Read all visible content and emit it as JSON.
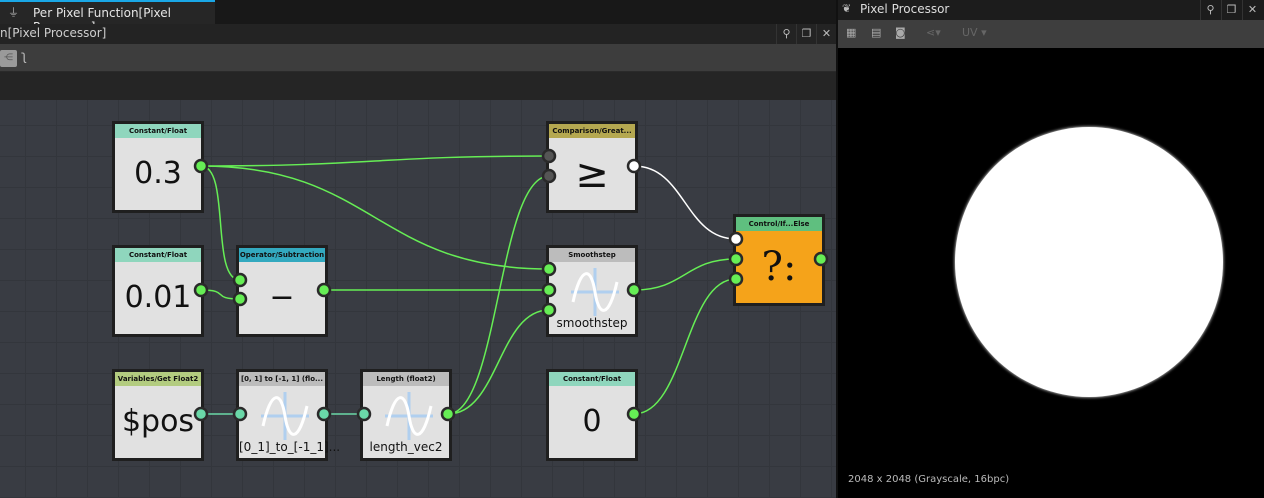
{
  "tab": {
    "label": "Per Pixel Function[Pixel Processor]"
  },
  "left_panel": {
    "title": "n[Pixel Processor]"
  },
  "right_panel": {
    "title": "Pixel Processor",
    "uv_label": "UV",
    "info": "2048 x 2048 (Grayscale, 16bpc)"
  },
  "colors": {
    "const": "#8fd6bd",
    "operator": "#33a9bf",
    "variable": "#b3cc80",
    "function": "#bcbcbc",
    "comparison": "#b5a850",
    "control": "#5fbf7f",
    "ifelse_body": "#f5a31a",
    "wire": "#66ee55",
    "wire_teal": "#6ad8a8"
  },
  "nodes": [
    {
      "id": "c03",
      "header": "Constant/Float",
      "value": "0.3",
      "type": "const"
    },
    {
      "id": "c001",
      "header": "Constant/Float",
      "value": "0.01",
      "type": "const"
    },
    {
      "id": "sub",
      "header": "Operator/Subtraction",
      "value": "−",
      "type": "operator"
    },
    {
      "id": "pos",
      "header": "Variables/Get Float2",
      "value": "$pos",
      "type": "variable"
    },
    {
      "id": "conv",
      "header": "[0, 1] to [-1, 1] (flo...",
      "caption": "[0_1]_to_[-1_1]...",
      "type": "function"
    },
    {
      "id": "len",
      "header": "Length (float2)",
      "caption": "length_vec2",
      "type": "function"
    },
    {
      "id": "cmp",
      "header": "Comparison/Great...",
      "value": "≥",
      "type": "comparison"
    },
    {
      "id": "smooth",
      "header": "Smoothstep",
      "caption": "smoothstep",
      "type": "function"
    },
    {
      "id": "c0",
      "header": "Constant/Float",
      "value": "0",
      "type": "const"
    },
    {
      "id": "ifelse",
      "header": "Control/If...Else",
      "value": "?:",
      "type": "control"
    }
  ],
  "connections": [
    [
      "c03.out",
      "cmp.in1"
    ],
    [
      "c03.out",
      "smooth.in1"
    ],
    [
      "c03.out",
      "sub.in1"
    ],
    [
      "c001.out",
      "sub.in2"
    ],
    [
      "sub.out",
      "smooth.in2"
    ],
    [
      "pos.out",
      "conv.in1"
    ],
    [
      "conv.out",
      "len.in1"
    ],
    [
      "len.out",
      "cmp.in2"
    ],
    [
      "len.out",
      "smooth.in3"
    ],
    [
      "cmp.out",
      "ifelse.in1"
    ],
    [
      "smooth.out",
      "ifelse.in2"
    ],
    [
      "c0.out",
      "ifelse.in3"
    ]
  ]
}
